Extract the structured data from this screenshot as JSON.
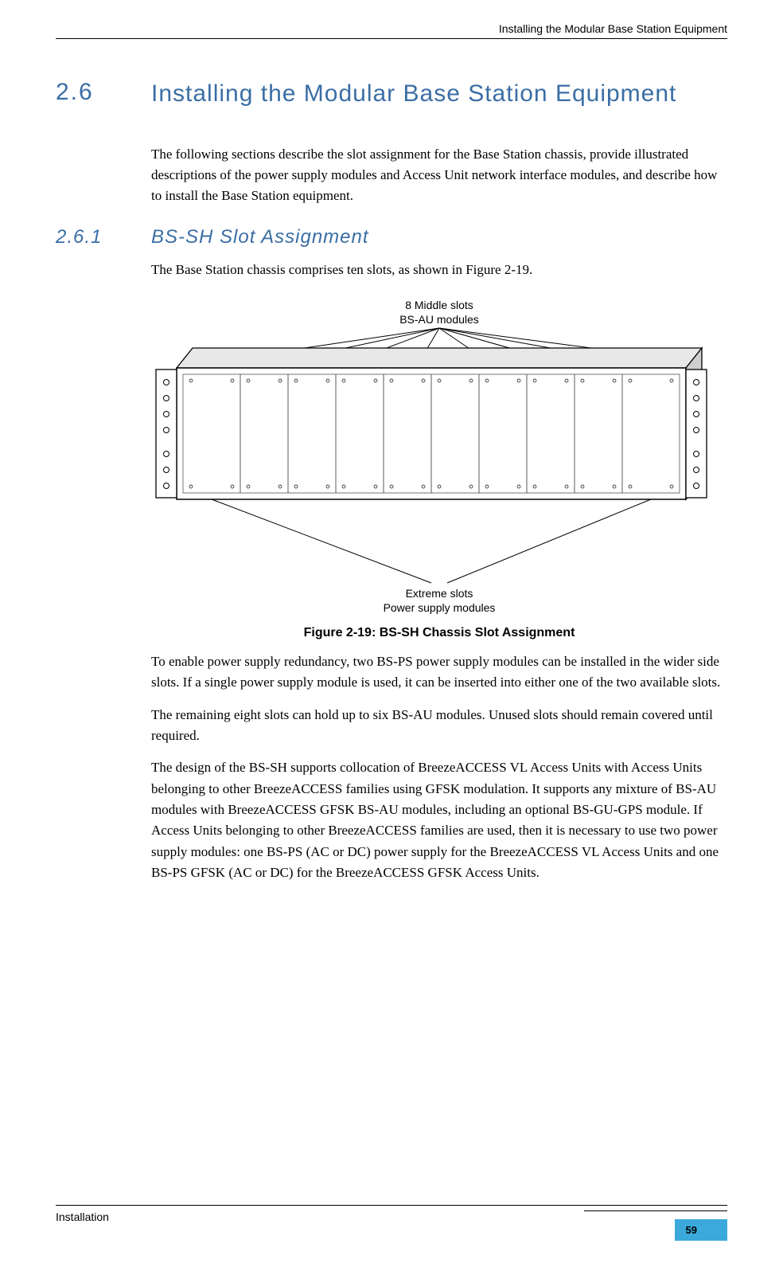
{
  "header": {
    "running_title": "Installing the Modular Base Station Equipment"
  },
  "section": {
    "num": "2.6",
    "title": "Installing the Modular Base Station Equipment",
    "intro": "The following sections describe the slot assignment for the Base Station chassis, provide illustrated descriptions of the power supply modules and Access Unit network interface modules, and describe how to install the Base Station equipment."
  },
  "subsection": {
    "num": "2.6.1",
    "title": "BS-SH Slot Assignment",
    "p1": "The Base Station chassis comprises ten slots, as shown in Figure 2-19.",
    "p2": "To enable power supply redundancy, two BS-PS power supply modules can be installed in the wider side slots. If a single power supply module is used, it can be inserted into either one of the two available slots.",
    "p3": "The remaining eight slots can hold up to six BS-AU modules. Unused slots should remain covered until required.",
    "p4": "The design of the BS-SH supports collocation of BreezeACCESS VL Access Units with Access Units belonging to other BreezeACCESS families using GFSK modulation. It supports any mixture of BS-AU modules with BreezeACCESS GFSK BS-AU modules, including an optional BS-GU-GPS module. If Access Units belonging to other BreezeACCESS families are used, then it is necessary to use two power supply modules: one BS-PS (AC or DC) power supply for the BreezeACCESS VL Access Units and one BS-PS GFSK (AC or DC) for the BreezeACCESS GFSK Access Units."
  },
  "figure": {
    "top_label_line1": "8 Middle slots",
    "top_label_line2": "BS-AU modules",
    "bottom_label_line1": "Extreme slots",
    "bottom_label_line2": "Power supply modules",
    "caption": "Figure 2-19: BS-SH Chassis Slot Assignment"
  },
  "footer": {
    "chapter": "Installation",
    "page": "59"
  }
}
